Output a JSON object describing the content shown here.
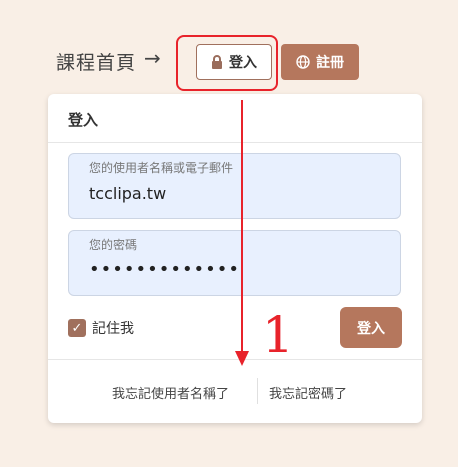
{
  "nav": {
    "breadcrumb": "課程首頁",
    "arrow": "→",
    "login_label": "登入",
    "register_label": "註冊"
  },
  "login_panel": {
    "title": "登入",
    "username_label": "您的使用者名稱或電子郵件",
    "username_value": "tcclipa.tw",
    "password_label": "您的密碼",
    "password_value": "•••••••••••••",
    "remember_label": "記住我",
    "remember_checked": true,
    "submit_label": "登入",
    "forgot_username": "我忘記使用者名稱了",
    "forgot_password": "我忘記密碼了"
  },
  "annotation": {
    "step_number": "1"
  },
  "colors": {
    "accent": "#b5775d",
    "annotation": "#e8232b",
    "background": "#f9efe6"
  }
}
